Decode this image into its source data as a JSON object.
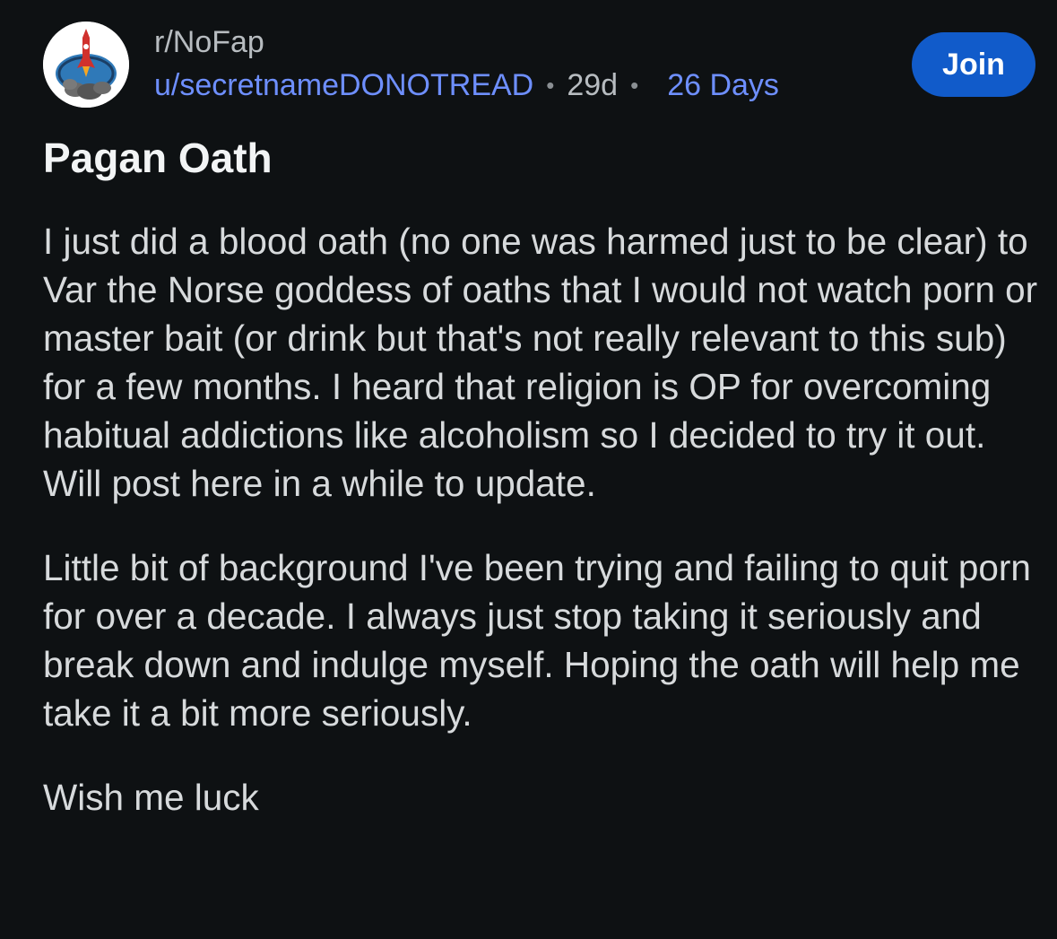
{
  "post": {
    "subreddit": "r/NoFap",
    "author": "u/secretnameDONOTREAD",
    "separator": "•",
    "age": "29d",
    "flair": "26 Days",
    "join_label": "Join",
    "title": "Pagan Oath",
    "paragraphs": [
      "I just did a blood oath (no one was harmed just to be clear) to Var the Norse goddess of oaths that I would not watch porn or master bait (or drink but that's not really relevant to this sub) for a few months. I heard that religion is OP for overcoming habitual addictions like alcoholism so I decided to try it out. Will post here in a while to update.",
      "Little bit of background I've been trying and failing to quit porn for over a decade. I always just stop taking it seriously and break down and indulge myself. Hoping the oath will help me take it a bit more seriously.",
      "Wish me luck"
    ]
  },
  "icons": {
    "avatar": "subreddit-rocket-icon"
  },
  "colors": {
    "background": "#0e1113",
    "link": "#6e8fff",
    "join_button": "#115bca",
    "title": "#f2f4f5",
    "body_text": "#d7dadc"
  }
}
